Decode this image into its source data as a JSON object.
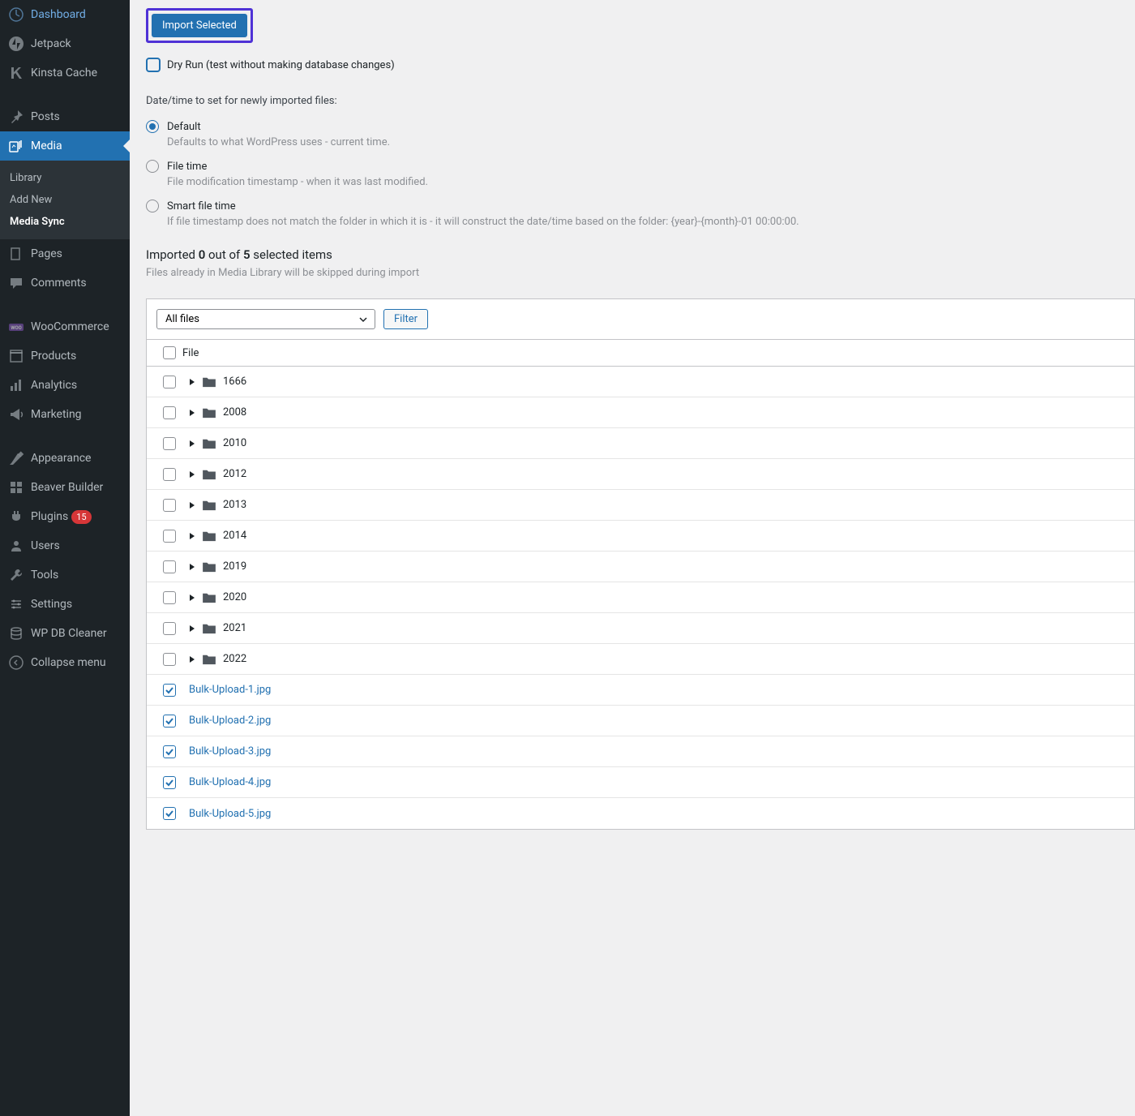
{
  "sidebar": {
    "items": [
      {
        "label": "Dashboard",
        "icon": "dashboard"
      },
      {
        "label": "Jetpack",
        "icon": "jetpack"
      },
      {
        "label": "Kinsta Cache",
        "icon": "kinsta"
      },
      {
        "label": "Posts",
        "icon": "pin",
        "sep_before": true
      },
      {
        "label": "Media",
        "icon": "media",
        "active": true
      },
      {
        "label": "Pages",
        "icon": "pages"
      },
      {
        "label": "Comments",
        "icon": "comments"
      },
      {
        "label": "WooCommerce",
        "icon": "woo",
        "sep_before": true
      },
      {
        "label": "Products",
        "icon": "products"
      },
      {
        "label": "Analytics",
        "icon": "analytics"
      },
      {
        "label": "Marketing",
        "icon": "marketing"
      },
      {
        "label": "Appearance",
        "icon": "appearance",
        "sep_before": true
      },
      {
        "label": "Beaver Builder",
        "icon": "beaver"
      },
      {
        "label": "Plugins",
        "icon": "plugins",
        "badge": "15"
      },
      {
        "label": "Users",
        "icon": "users"
      },
      {
        "label": "Tools",
        "icon": "tools"
      },
      {
        "label": "Settings",
        "icon": "settings"
      },
      {
        "label": "WP DB Cleaner",
        "icon": "db"
      },
      {
        "label": "Collapse menu",
        "icon": "collapse"
      }
    ],
    "submenu": [
      {
        "label": "Library"
      },
      {
        "label": "Add New"
      },
      {
        "label": "Media Sync",
        "current": true
      }
    ]
  },
  "import_button": "Import Selected",
  "dry_run_label": "Dry Run (test without making database changes)",
  "date_section_label": "Date/time to set for newly imported files:",
  "date_options": [
    {
      "label": "Default",
      "desc": "Defaults to what WordPress uses - current time.",
      "checked": true
    },
    {
      "label": "File time",
      "desc": "File modification timestamp - when it was last modified."
    },
    {
      "label": "Smart file time",
      "desc": "If file timestamp does not match the folder in which it is - it will construct the date/time based on the folder: {year}-{month}-01 00:00:00."
    }
  ],
  "status": {
    "prefix": "Imported ",
    "done": "0",
    "mid": " out of ",
    "total": "5",
    "suffix": " selected items",
    "sub": "Files already in Media Library will be skipped during import"
  },
  "filter": {
    "select_value": "All files",
    "button": "Filter"
  },
  "table": {
    "header": "File",
    "rows": [
      {
        "name": "1666",
        "type": "folder"
      },
      {
        "name": "2008",
        "type": "folder"
      },
      {
        "name": "2010",
        "type": "folder"
      },
      {
        "name": "2012",
        "type": "folder"
      },
      {
        "name": "2013",
        "type": "folder"
      },
      {
        "name": "2014",
        "type": "folder"
      },
      {
        "name": "2019",
        "type": "folder"
      },
      {
        "name": "2020",
        "type": "folder"
      },
      {
        "name": "2021",
        "type": "folder"
      },
      {
        "name": "2022",
        "type": "folder"
      },
      {
        "name": "Bulk-Upload-1.jpg",
        "type": "file",
        "checked": true
      },
      {
        "name": "Bulk-Upload-2.jpg",
        "type": "file",
        "checked": true
      },
      {
        "name": "Bulk-Upload-3.jpg",
        "type": "file",
        "checked": true
      },
      {
        "name": "Bulk-Upload-4.jpg",
        "type": "file",
        "checked": true
      },
      {
        "name": "Bulk-Upload-5.jpg",
        "type": "file",
        "checked": true
      }
    ]
  }
}
